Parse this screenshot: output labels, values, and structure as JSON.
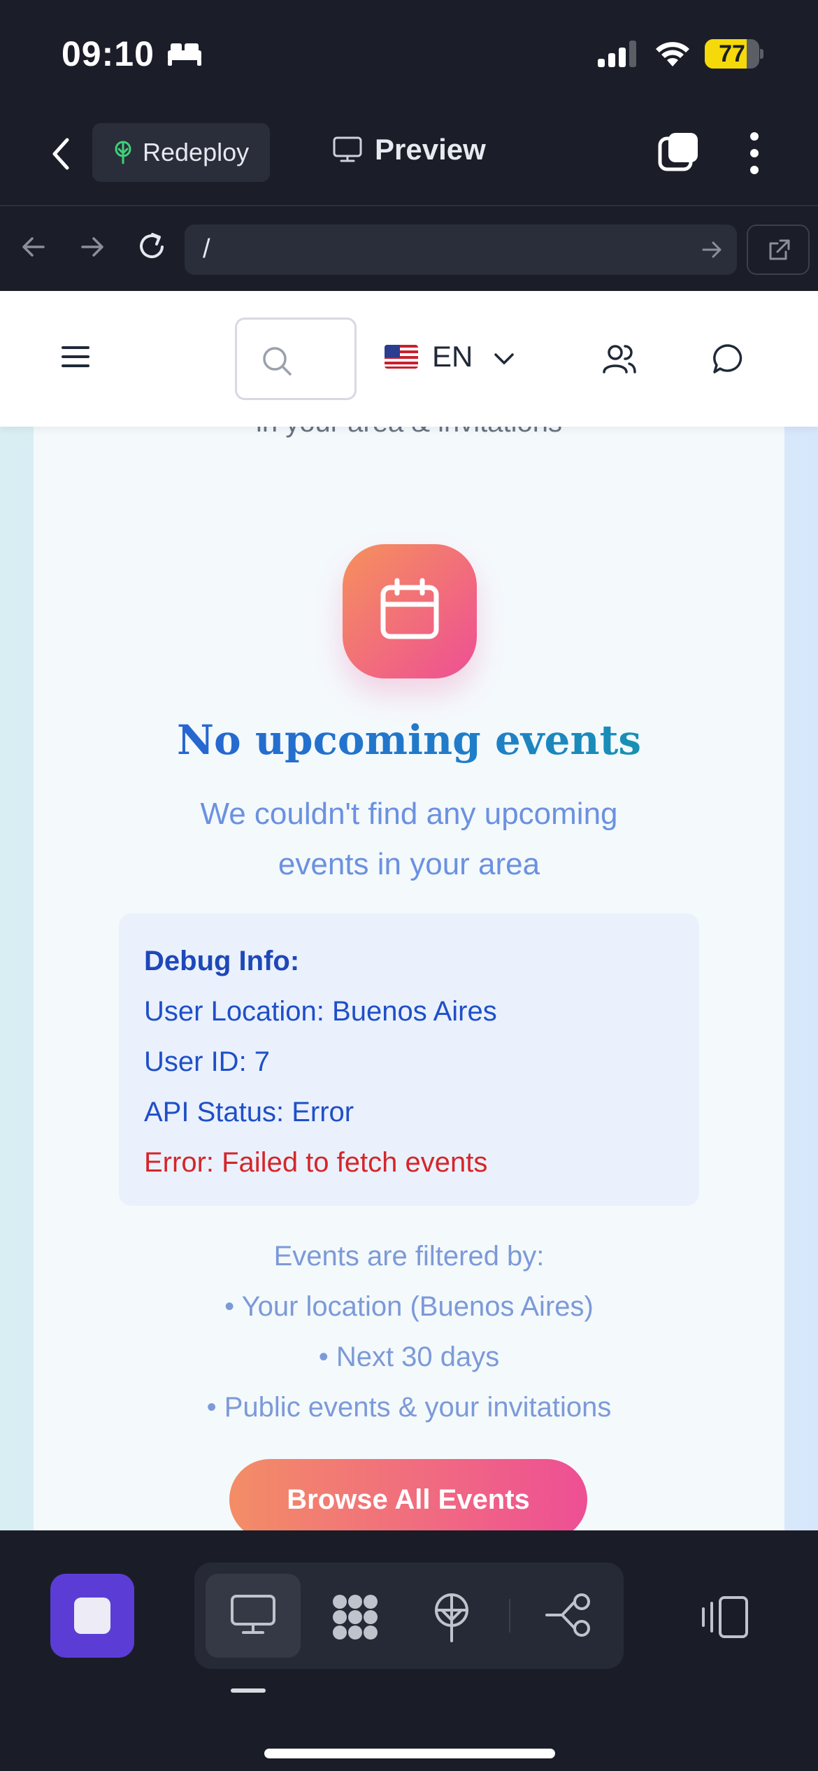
{
  "status_bar": {
    "time": "09:10",
    "battery_level": "77",
    "battery_fraction": 0.77,
    "battery_color": "#f5d90a"
  },
  "app_toolbar": {
    "redeploy_label": "Redeploy",
    "preview_label": "Preview"
  },
  "browser": {
    "url": "/"
  },
  "site_nav": {
    "language_code": "EN",
    "language_flag": "us-flag"
  },
  "page": {
    "partial_text": "in your area & invitations",
    "empty_title": "No upcoming events",
    "empty_subtitle": "We couldn't find any upcoming events in your area",
    "debug": {
      "title": "Debug Info:",
      "location": "User Location: Buenos Aires",
      "user_id": "User ID: 7",
      "api_status": "API Status: Error",
      "error": "Error: Failed to fetch events"
    },
    "filters": {
      "heading": "Events are filtered by:",
      "items": [
        "• Your location (Buenos Aires)",
        "• Next 30 days",
        "• Public events & your invitations"
      ]
    },
    "browse_button": "Browse All Events",
    "accent_gradient": [
      "#f5915c",
      "#ee4f95"
    ]
  },
  "bottom_bar": {
    "stop_color": "#5b3dd6",
    "active_tab": "preview"
  }
}
